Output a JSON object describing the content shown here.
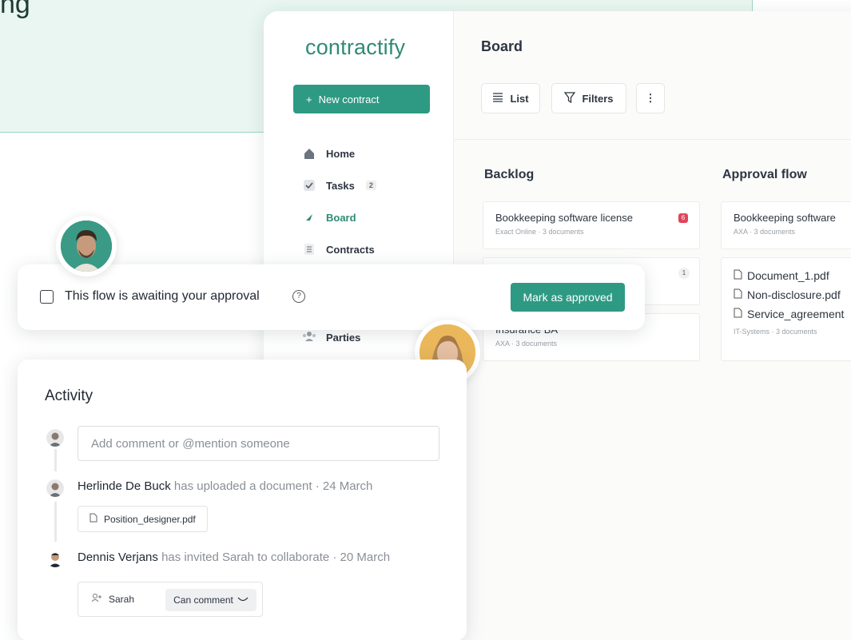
{
  "hero": {
    "text": "ng"
  },
  "app": {
    "logo": "contractify",
    "new_contract_label": "New contract",
    "nav": [
      {
        "label": "Home",
        "icon": "home-icon"
      },
      {
        "label": "Tasks",
        "icon": "tasks-icon",
        "count": "2"
      },
      {
        "label": "Board",
        "icon": "board-icon"
      },
      {
        "label": "Contracts",
        "icon": "contracts-icon"
      }
    ],
    "parties_label": "Parties",
    "board_title": "Board",
    "toolbar": {
      "list_label": "List",
      "filters_label": "Filters",
      "more_label": "⋮"
    },
    "columns": {
      "backlog": {
        "title": "Backlog",
        "card1": {
          "title": "Bookkeeping software license",
          "subtitle": "Exact Online · 3 documents",
          "badge": "6"
        },
        "card2": {
          "badge": "1"
        },
        "card3": {
          "title": "Insurance BA",
          "subtitle": "AXA · 3 documents"
        }
      },
      "approval": {
        "title": "Approval flow",
        "card1": {
          "title": "Bookkeeping software",
          "subtitle": "AXA · 3 documents"
        },
        "docs": [
          "Document_1.pdf",
          "Non-disclosure.pdf",
          "Service_agreement"
        ],
        "docs_subtitle": "IT-Systems · 3 documents"
      }
    }
  },
  "approval_bar": {
    "text": "This flow is awaiting your approval",
    "help": "?",
    "button_label": "Mark as approved"
  },
  "activity": {
    "title": "Activity",
    "comment_placeholder": "Add comment or @mention someone",
    "events": [
      {
        "actor": "Herlinde De Buck",
        "text": "has uploaded a document · 24 March",
        "file": "Position_designer.pdf"
      },
      {
        "actor": "Dennis Verjans",
        "text": "has invited Sarah to collaborate · 20 March"
      }
    ],
    "share": {
      "name": "Sarah",
      "permission": "Can comment"
    }
  },
  "colors": {
    "brand": "#2f9a83",
    "mint": "#e9f6f1",
    "badge_red": "#e0455a"
  }
}
